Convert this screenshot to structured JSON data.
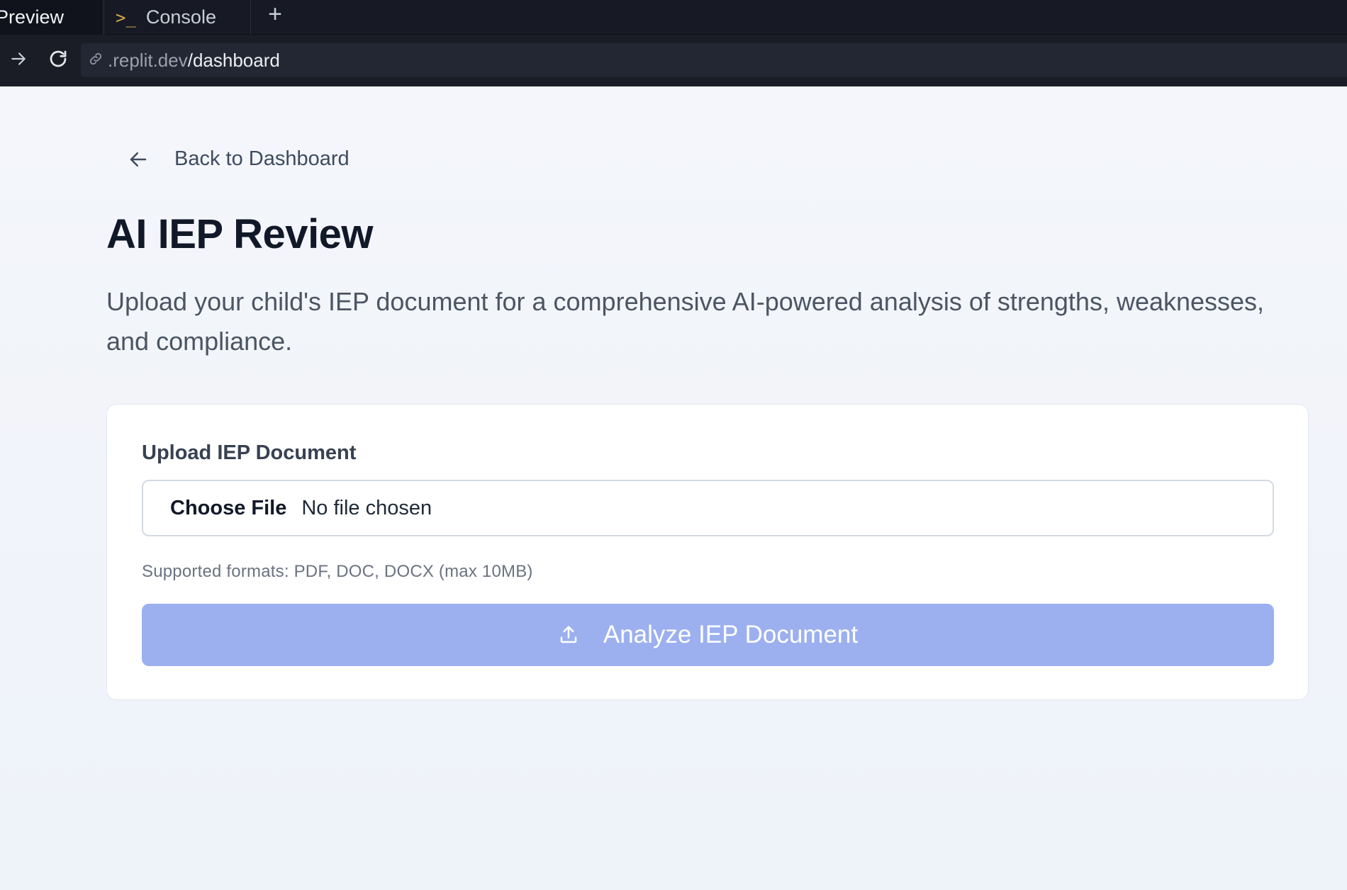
{
  "tabs": [
    {
      "label": "Preview",
      "active": true
    },
    {
      "label": "Console",
      "icon": "terminal-prompt-icon",
      "active": false
    }
  ],
  "add_tab_icon": "plus-icon",
  "url_bar": {
    "host": ".replit.dev",
    "path": "/dashboard"
  },
  "page": {
    "back_link": "Back to Dashboard",
    "title": "AI IEP Review",
    "description": "Upload your child's IEP document for a comprehensive AI-powered analysis of strengths, weaknesses, and compliance.",
    "upload_card": {
      "label": "Upload IEP Document",
      "choose_file": "Choose File",
      "file_status": "No file chosen",
      "helper": "Supported formats: PDF, DOC, DOCX (max 10MB)",
      "submit_label": "Analyze IEP Document",
      "submit_disabled": true
    }
  },
  "colors": {
    "accent_disabled": "#9cb0ef",
    "title": "#111827",
    "chrome_bg": "#171a24"
  }
}
